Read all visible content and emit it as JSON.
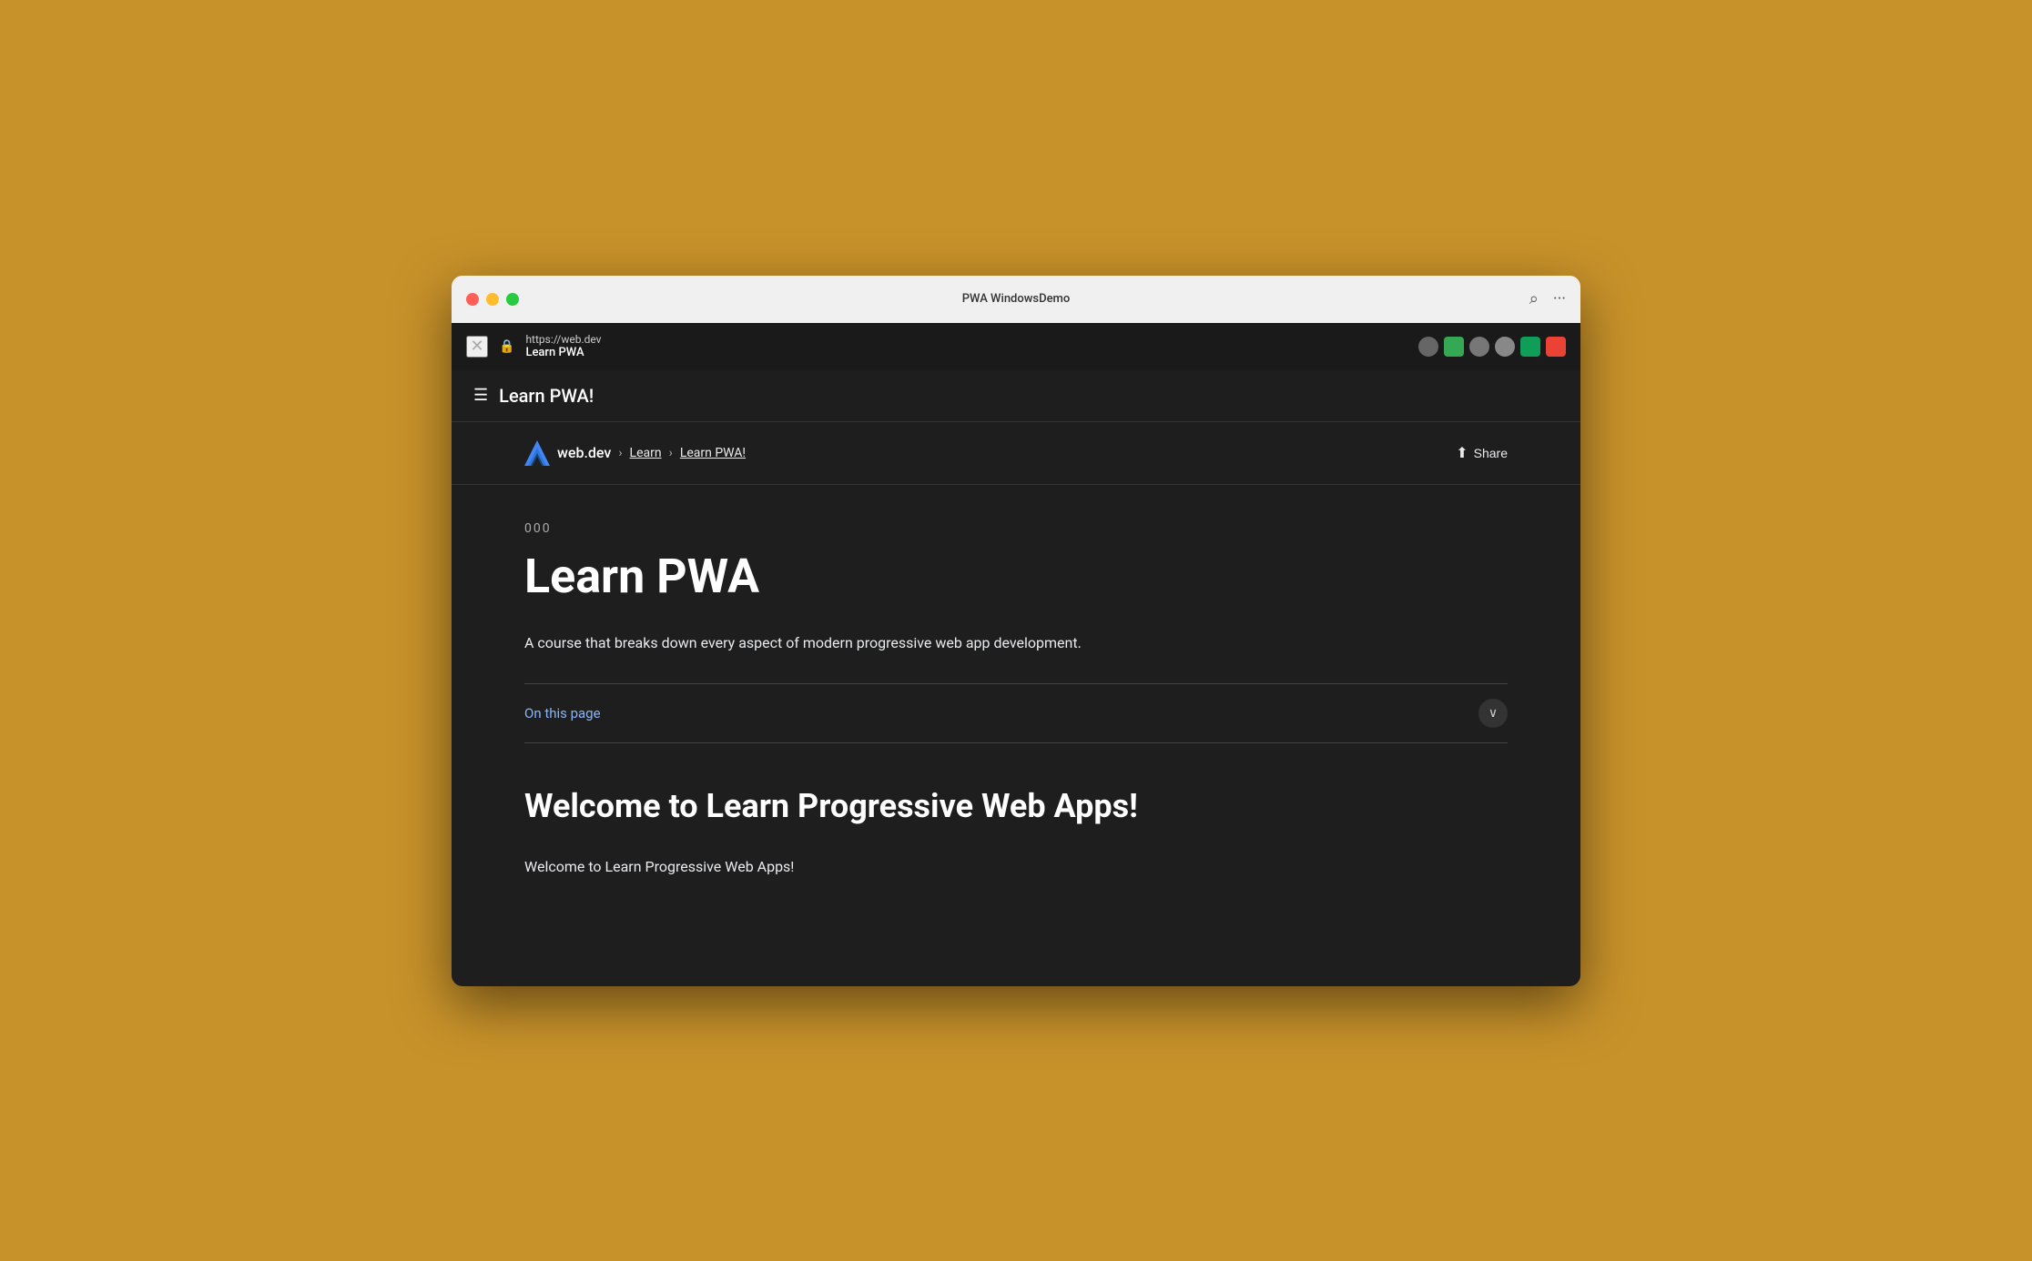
{
  "window": {
    "title": "PWA WindowsDemo",
    "traffic_lights": {
      "close_label": "close",
      "minimize_label": "minimize",
      "maximize_label": "maximize"
    }
  },
  "browser_bar": {
    "url": "https://web.dev",
    "page_title": "Learn PWA",
    "close_icon": "×",
    "lock_icon": "🔒"
  },
  "app_header": {
    "title": "Learn PWA!",
    "hamburger_icon": "☰"
  },
  "breadcrumb": {
    "logo_text": "web.dev",
    "learn_label": "Learn",
    "page_label": "Learn PWA!",
    "separator": "›"
  },
  "share_button": {
    "label": "Share",
    "icon": "⬆"
  },
  "content": {
    "section_number": "000",
    "page_title": "Learn PWA",
    "description": "A course that breaks down every aspect of modern progressive web app development.",
    "on_this_page_label": "On this page",
    "section_heading": "Welcome to Learn Progressive Web Apps!",
    "section_text": "Welcome to Learn Progressive Web Apps!"
  },
  "icons": {
    "chevron_down": "⌄",
    "zoom_icon": "⌕",
    "more_icon": "⋯"
  }
}
